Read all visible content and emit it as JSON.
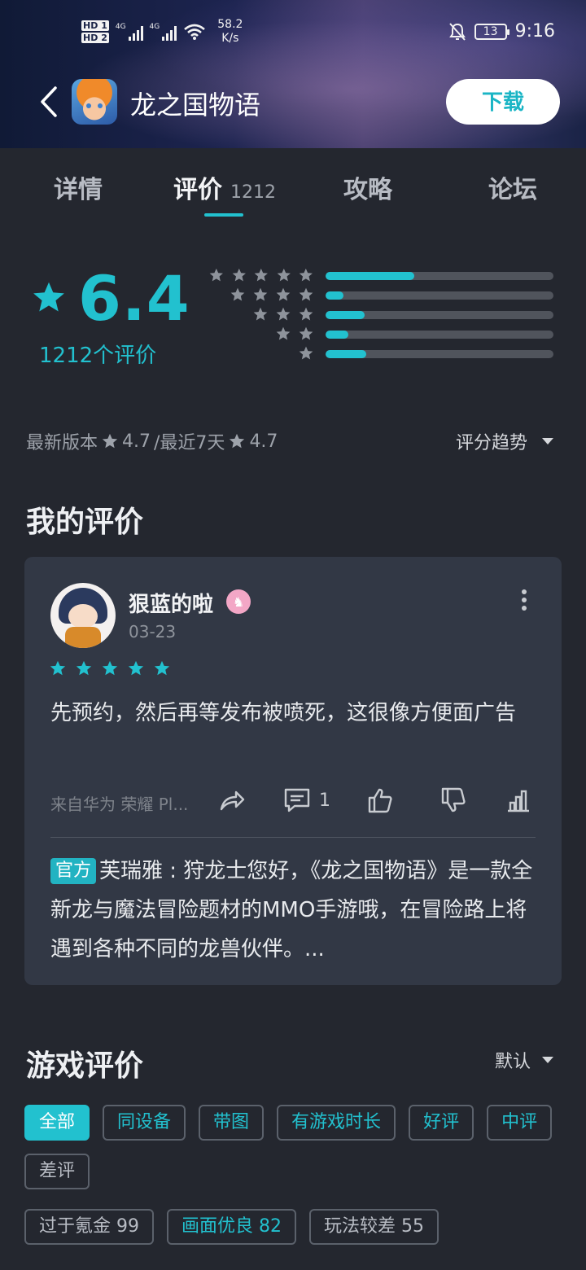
{
  "status_bar": {
    "hd1": "HD",
    "hd1_sub": "1",
    "hd2": "HD",
    "hd2_sub": "2",
    "net1": "4G",
    "net2": "4G",
    "speed_value": "58.2",
    "speed_unit": "K/s",
    "battery": "13",
    "time": "9:16"
  },
  "header": {
    "app_title": "龙之国物语",
    "download_label": "下载"
  },
  "tabs": [
    {
      "label": "详情"
    },
    {
      "label": "评价",
      "count": "1212"
    },
    {
      "label": "攻略"
    },
    {
      "label": "论坛"
    }
  ],
  "rating": {
    "score": "6.4",
    "count_text": "1212个评价",
    "distribution": [
      {
        "stars": 5,
        "fraction": 0.39
      },
      {
        "stars": 4,
        "fraction": 0.08
      },
      {
        "stars": 3,
        "fraction": 0.17
      },
      {
        "stars": 2,
        "fraction": 0.1
      },
      {
        "stars": 1,
        "fraction": 0.18
      }
    ],
    "latest_version_label": "最新版本",
    "latest_version_score": "4.7",
    "recent_label": "/最近7天",
    "recent_score": "4.7",
    "trend_label": "评分趋势"
  },
  "my_review": {
    "section_title": "我的评价",
    "username": "狠蓝的啦",
    "date": "03-23",
    "stars": 5,
    "text": "先预约，然后再等发布被喷死，这很像方便面广告",
    "device": "来自华为 荣耀 Pl...",
    "comment_count": "1",
    "official_tag": "官方",
    "reply_text": "芙瑞雅 : 狩龙士您好，《龙之国物语》是一款全新龙与魔法冒险题材的MMO手游哦，在冒险路上将遇到各种不同的龙兽伙伴。..."
  },
  "game_reviews": {
    "section_title": "游戏评价",
    "sort_label": "默认",
    "filters": [
      "全部",
      "同设备",
      "带图",
      "有游戏时长",
      "好评",
      "中评",
      "差评"
    ],
    "tags": [
      "过于氪金 99",
      "画面优良 82",
      "玩法较差 55"
    ]
  },
  "colors": {
    "accent": "#22c1cf",
    "background": "#24272f",
    "card": "#323845"
  }
}
